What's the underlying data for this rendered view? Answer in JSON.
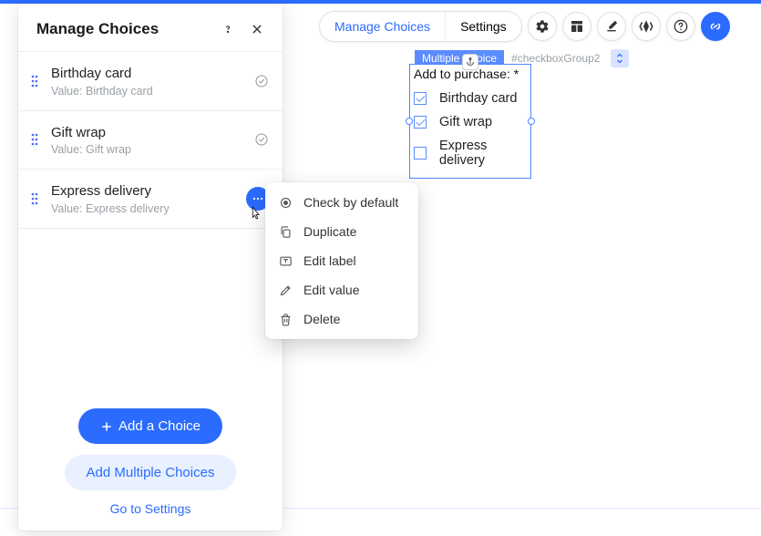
{
  "panel": {
    "title": "Manage Choices",
    "choices": [
      {
        "label": "Birthday card",
        "value_prefix": "Value: ",
        "value": "Birthday card",
        "checked": true,
        "show_actions": false
      },
      {
        "label": "Gift wrap",
        "value_prefix": "Value: ",
        "value": "Gift wrap",
        "checked": true,
        "show_actions": false
      },
      {
        "label": "Express delivery",
        "value_prefix": "Value: ",
        "value": "Express delivery",
        "checked": false,
        "show_actions": true
      }
    ],
    "add_choice": "Add a Choice",
    "add_multiple": "Add Multiple Choices",
    "go_settings": "Go to Settings"
  },
  "toolbar": {
    "manage": "Manage Choices",
    "settings": "Settings"
  },
  "component": {
    "tag": "Multiple Choice",
    "id": "#checkboxGroup2",
    "legend": "Add to purchase: *",
    "options": [
      {
        "label": "Birthday card",
        "checked": true
      },
      {
        "label": "Gift wrap",
        "checked": true
      },
      {
        "label": "Express delivery",
        "checked": false
      }
    ]
  },
  "context_menu": {
    "items": [
      {
        "icon": "radio",
        "label": "Check by default"
      },
      {
        "icon": "copy",
        "label": "Duplicate"
      },
      {
        "icon": "text",
        "label": "Edit label"
      },
      {
        "icon": "pencil",
        "label": "Edit value"
      },
      {
        "icon": "trash",
        "label": "Delete"
      }
    ]
  }
}
